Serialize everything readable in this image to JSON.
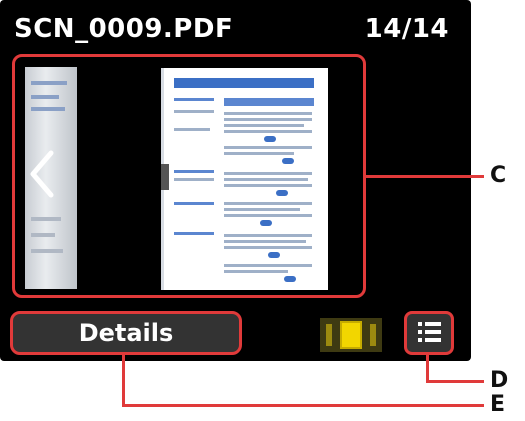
{
  "header": {
    "file_name": "SCN_0009.PDF",
    "page_counter": "14/14"
  },
  "preview": {
    "prev_icon": "chevron-left-icon"
  },
  "buttons": {
    "details_label": "Details",
    "single_view_icon": "single-page-view-icon",
    "list_view_icon": "list-view-icon"
  },
  "callouts": {
    "c": "C",
    "d": "D",
    "e": "E"
  },
  "colors": {
    "highlight": "#e03a3a",
    "active_view": "#f2d600"
  }
}
